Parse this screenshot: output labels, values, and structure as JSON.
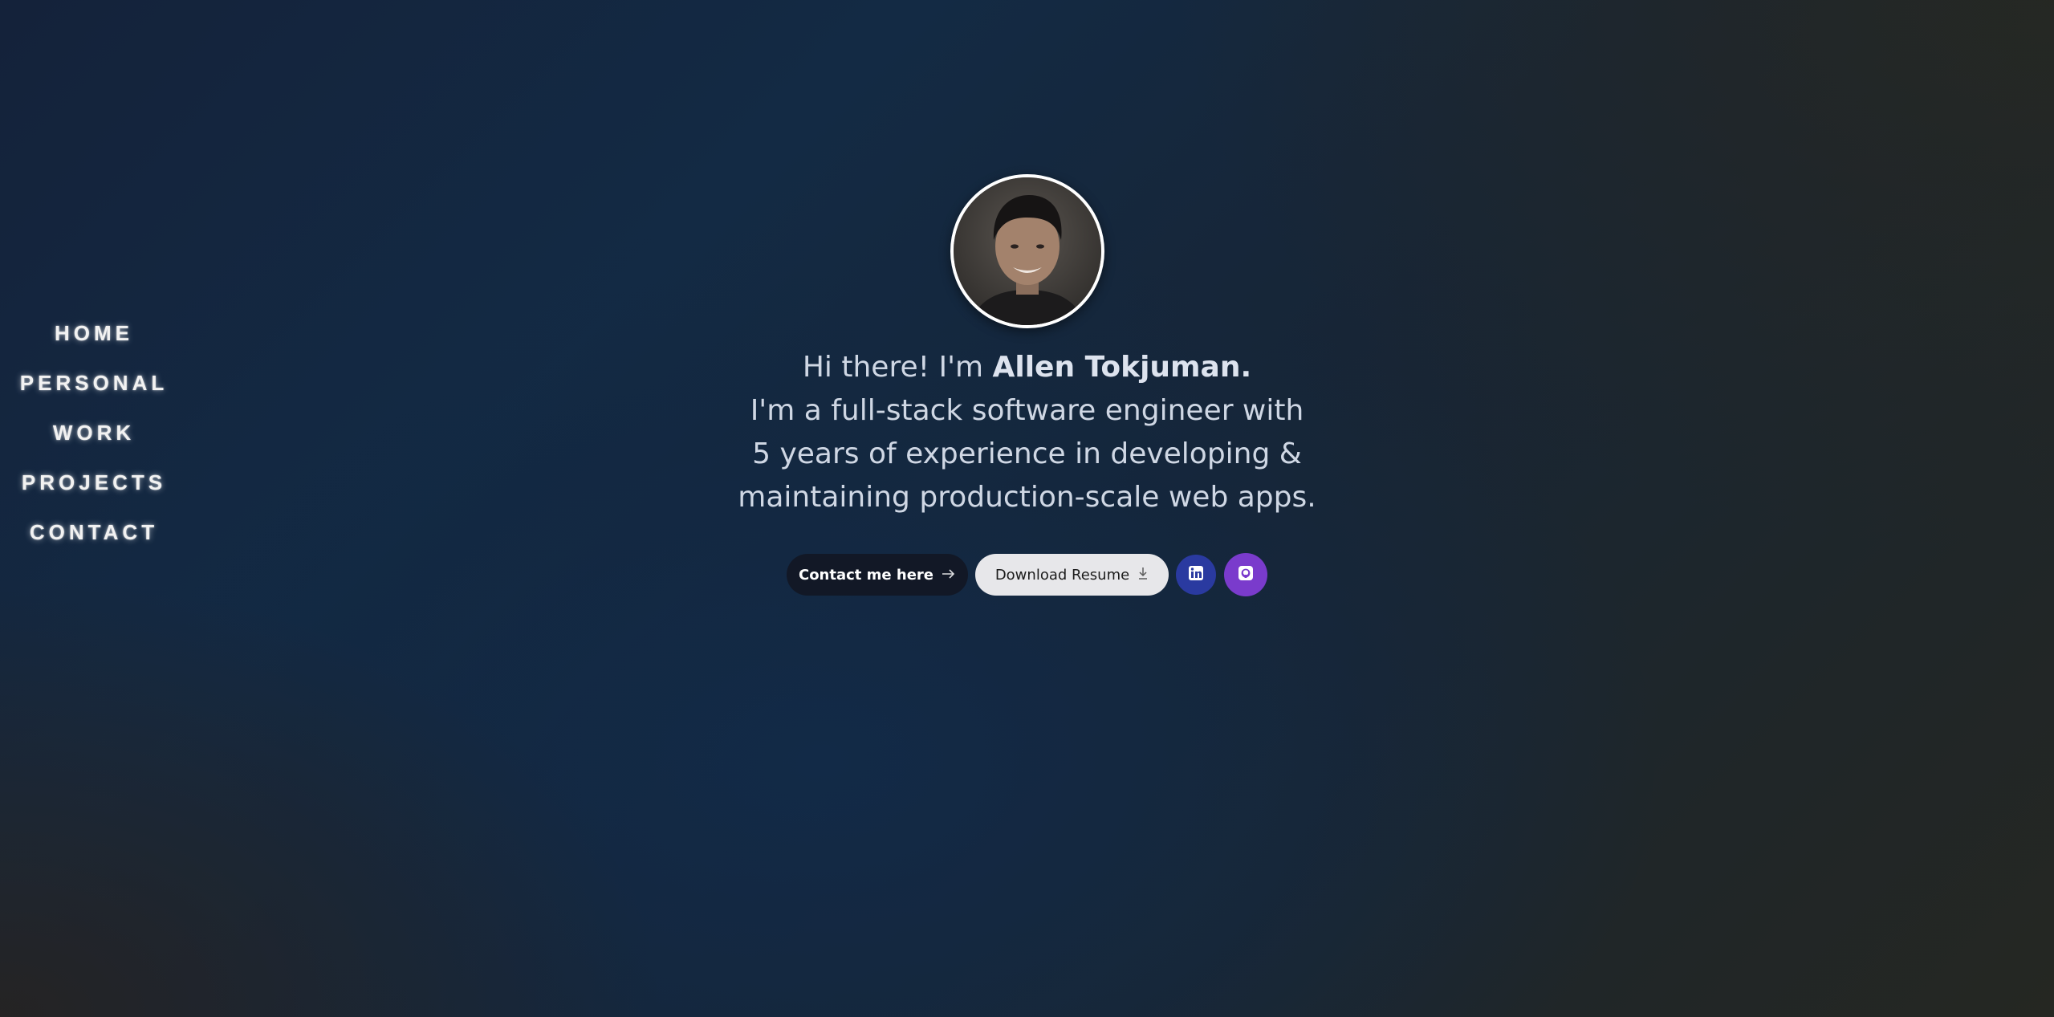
{
  "nav": {
    "items": [
      {
        "label": "HOME"
      },
      {
        "label": "PERSONAL"
      },
      {
        "label": "WORK"
      },
      {
        "label": "PROJECTS"
      },
      {
        "label": "CONTACT"
      }
    ]
  },
  "hero": {
    "greeting": "Hi there! I'm ",
    "name": "Allen Tokjuman.",
    "line2": "I'm a full-stack software engineer with",
    "line3": "5 years of experience in developing &",
    "line4": "maintaining production-scale web apps."
  },
  "actions": {
    "contact_label": "Contact me here",
    "contact_icon": "arrow-right-icon",
    "resume_label": "Download Resume",
    "resume_icon": "download-icon",
    "linkedin_icon": "linkedin-icon",
    "github_icon": "github-icon"
  },
  "colors": {
    "contact_button_bg": "#121826",
    "resume_button_bg": "#e7e7ea",
    "linkedin_bg": "#2a3aa0",
    "github_bg": "#7a3bcc",
    "text_primary": "#cfd7e4"
  }
}
